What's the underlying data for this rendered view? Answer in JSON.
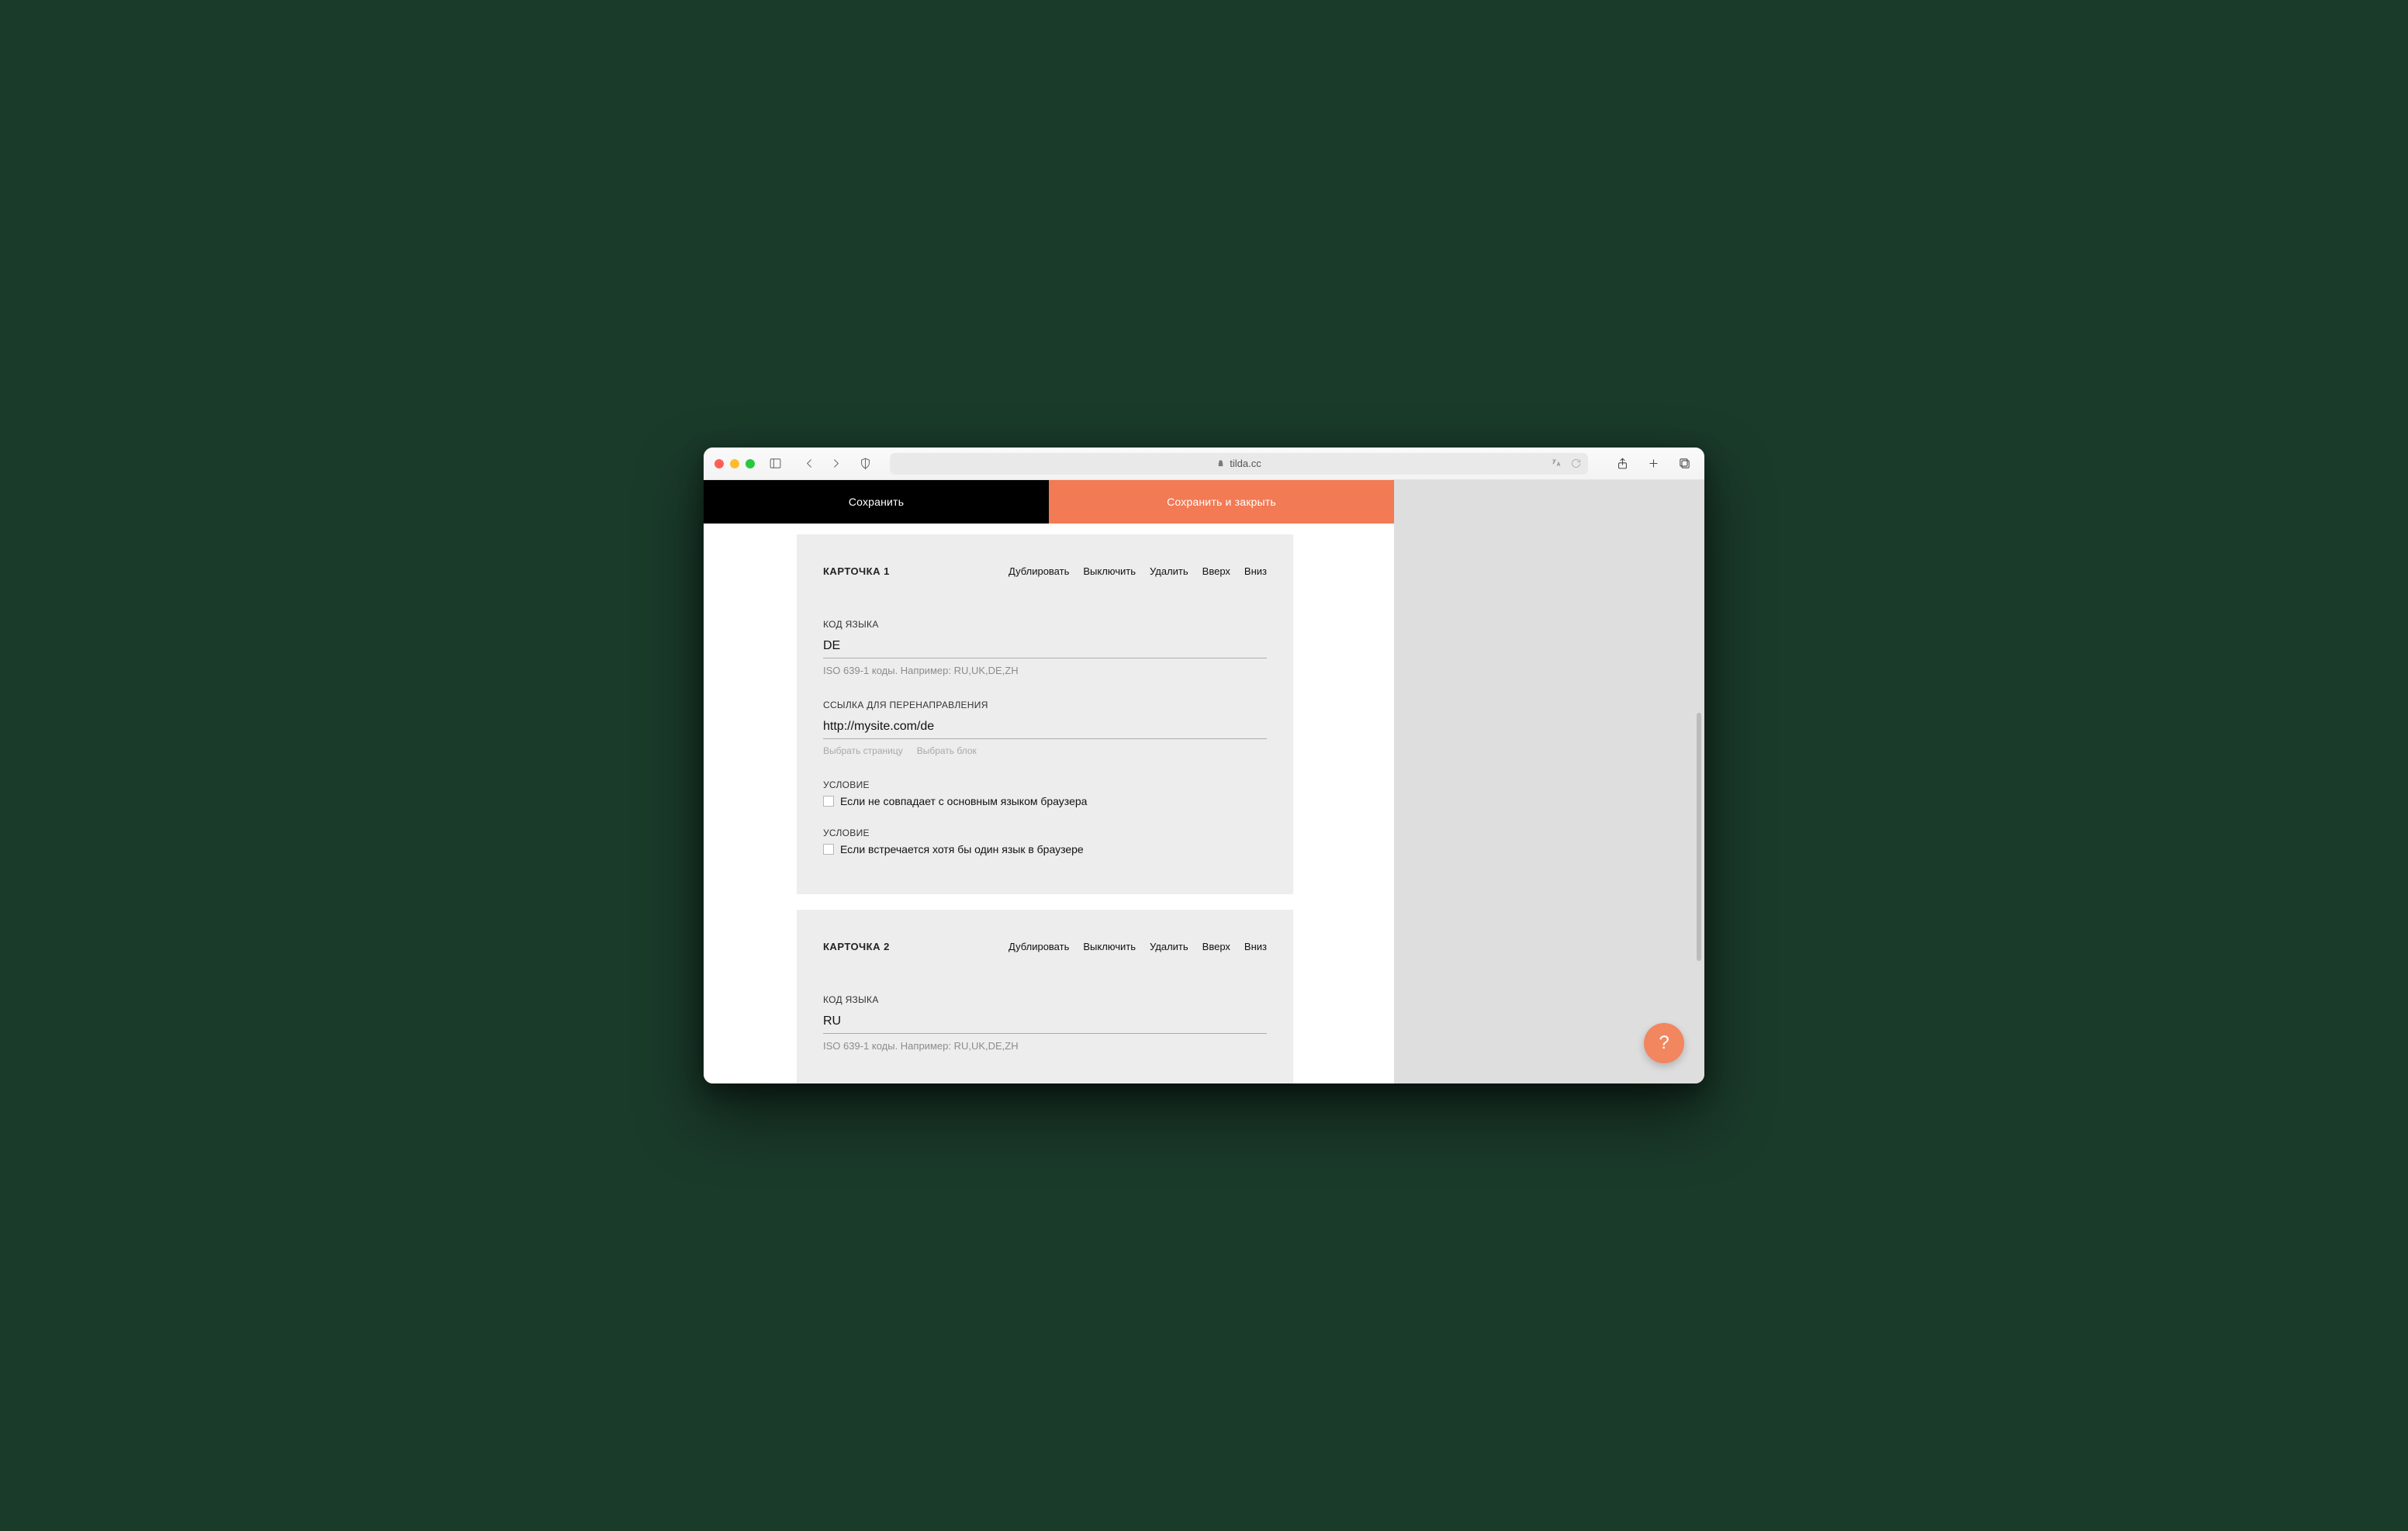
{
  "browser": {
    "url_host": "tilda.cc"
  },
  "header": {
    "save": "Сохранить",
    "save_close": "Сохранить и закрыть"
  },
  "card_actions": {
    "duplicate": "Дублировать",
    "disable": "Выключить",
    "delete": "Удалить",
    "up": "Вверх",
    "down": "Вниз"
  },
  "labels": {
    "lang_code": "КОД ЯЗЫКА",
    "lang_hint": "ISO 639-1 коды. Например: RU,UK,DE,ZH",
    "redirect": "ССЫЛКА ДЛЯ ПЕРЕНАПРАВЛЕНИЯ",
    "pick_page": "Выбрать страницу",
    "pick_block": "Выбрать блок",
    "condition": "УСЛОВИЕ",
    "cond1": "Если не совпадает с основным языком браузера",
    "cond2": "Если встречается хотя бы один язык в браузере"
  },
  "cards": [
    {
      "title": "КАРТОЧКА 1",
      "lang": "DE",
      "url": "http://mysite.com/de"
    },
    {
      "title": "КАРТОЧКА 2",
      "lang": "RU",
      "url": ""
    }
  ],
  "fab": "?"
}
